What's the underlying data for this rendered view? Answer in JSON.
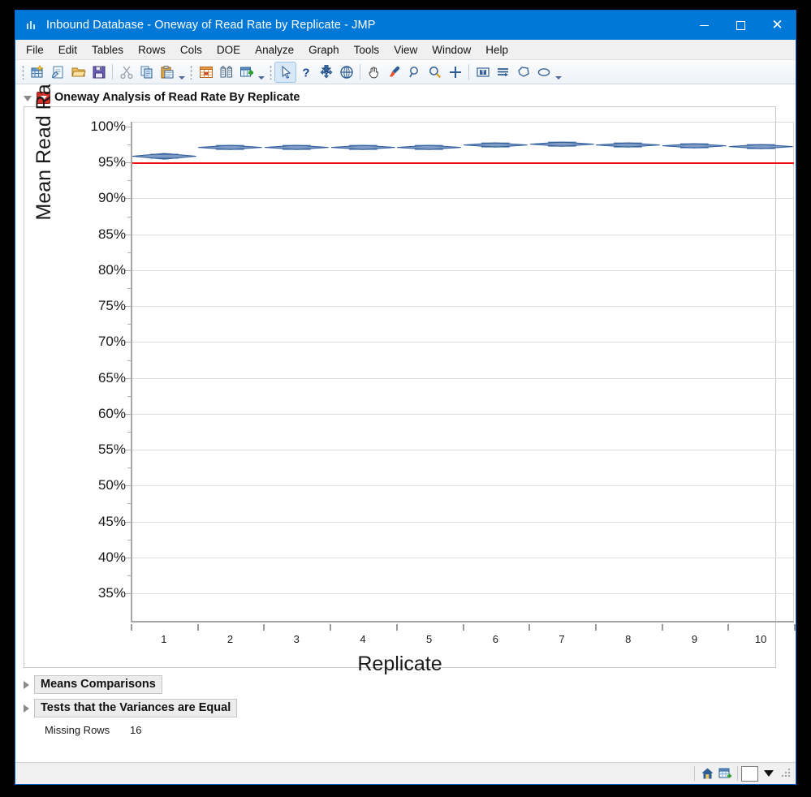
{
  "window": {
    "title": "Inbound Database - Oneway of Read Rate by Replicate - JMP",
    "app_icon": "jmp-bars-icon",
    "buttons": {
      "minimize": "minimize",
      "maximize": "maximize",
      "close": "close"
    },
    "accent_color": "#0078d7"
  },
  "menubar": {
    "items": [
      {
        "label": "File"
      },
      {
        "label": "Edit"
      },
      {
        "label": "Tables"
      },
      {
        "label": "Rows"
      },
      {
        "label": "Cols"
      },
      {
        "label": "DOE"
      },
      {
        "label": "Analyze"
      },
      {
        "label": "Graph"
      },
      {
        "label": "Tools"
      },
      {
        "label": "View"
      },
      {
        "label": "Window"
      },
      {
        "label": "Help"
      }
    ]
  },
  "toolbar": {
    "groups": [
      {
        "icons": [
          "new-data-table-icon",
          "new-script-icon",
          "open-file-icon",
          "save-icon"
        ],
        "separator_after": true,
        "icons2": [
          "cut-icon",
          "copy-icon",
          "paste-icon"
        ],
        "overflow": "more-commands"
      },
      {
        "icons": [
          "subset-table-icon",
          "column-viewer-icon",
          "new-column-icon"
        ],
        "overflow": "more-commands"
      },
      {
        "icons": [
          "arrow-select-icon",
          "help-question-icon",
          "move-crosshair-icon",
          "scroller-icon"
        ],
        "icons2": [
          "grabber-hand-icon",
          "brush-icon",
          "lasso-icon",
          "magnifier-icon",
          "crosshair-plus-icon"
        ],
        "icons3": [
          "text-annotate-icon",
          "line-tool-icon",
          "polygon-tool-icon",
          "ellipse-tool-icon"
        ],
        "overflow": "more-commands"
      }
    ]
  },
  "report": {
    "outline_title": "Oneway Analysis of Read Rate By Replicate",
    "outline_disclosure": "open",
    "sub_nodes": [
      {
        "label": "Means Comparisons",
        "state": "closed"
      },
      {
        "label": "Tests that the Variances are Equal",
        "state": "closed"
      }
    ],
    "missing_rows": {
      "label": "Missing Rows",
      "value": "16"
    }
  },
  "statusbar": {
    "home_icon": "home-icon",
    "datatable_icon": "data-table-icon",
    "select_box": "white-box",
    "dropdown_caret": "caret-down-icon",
    "resize_grip": "resize-grip"
  },
  "chart_data": {
    "type": "bar",
    "chart_kind": "oneway-means-diamonds",
    "title": "Oneway Analysis of Read Rate By Replicate",
    "xlabel": "Replicate",
    "ylabel": "Mean Read Rate",
    "categories": [
      "1",
      "2",
      "3",
      "4",
      "5",
      "6",
      "7",
      "8",
      "9",
      "10"
    ],
    "values": [
      95.9,
      97.1,
      97.1,
      97.1,
      97.1,
      97.4,
      97.6,
      97.4,
      97.3,
      97.2
    ],
    "ci_lower": [
      95.5,
      96.8,
      96.8,
      96.8,
      96.8,
      97.1,
      97.3,
      97.1,
      97.0,
      96.9
    ],
    "ci_upper": [
      96.3,
      97.4,
      97.4,
      97.4,
      97.4,
      97.7,
      97.9,
      97.7,
      97.6,
      97.5
    ],
    "grand_mean_reference": 95.0,
    "reference_line_color": "#ee1111",
    "diamond_color": "#2f5d9e",
    "ylim": [
      35,
      101
    ],
    "ytick_values": [
      100,
      95,
      90,
      85,
      80,
      75,
      70,
      65,
      60,
      55,
      50,
      45,
      40,
      35
    ],
    "ytick_labels": [
      "100%",
      "95%",
      "90%",
      "85%",
      "80%",
      "75%",
      "70%",
      "65%",
      "60%",
      "55%",
      "50%",
      "45%",
      "40%",
      "35%"
    ],
    "minor_ticks": [
      97.5,
      92.5,
      87.5,
      82.5,
      77.5,
      72.5,
      67.5,
      62.5,
      57.5,
      52.5,
      47.5,
      42.5,
      37.5
    ],
    "grid": true,
    "legend": "none"
  }
}
